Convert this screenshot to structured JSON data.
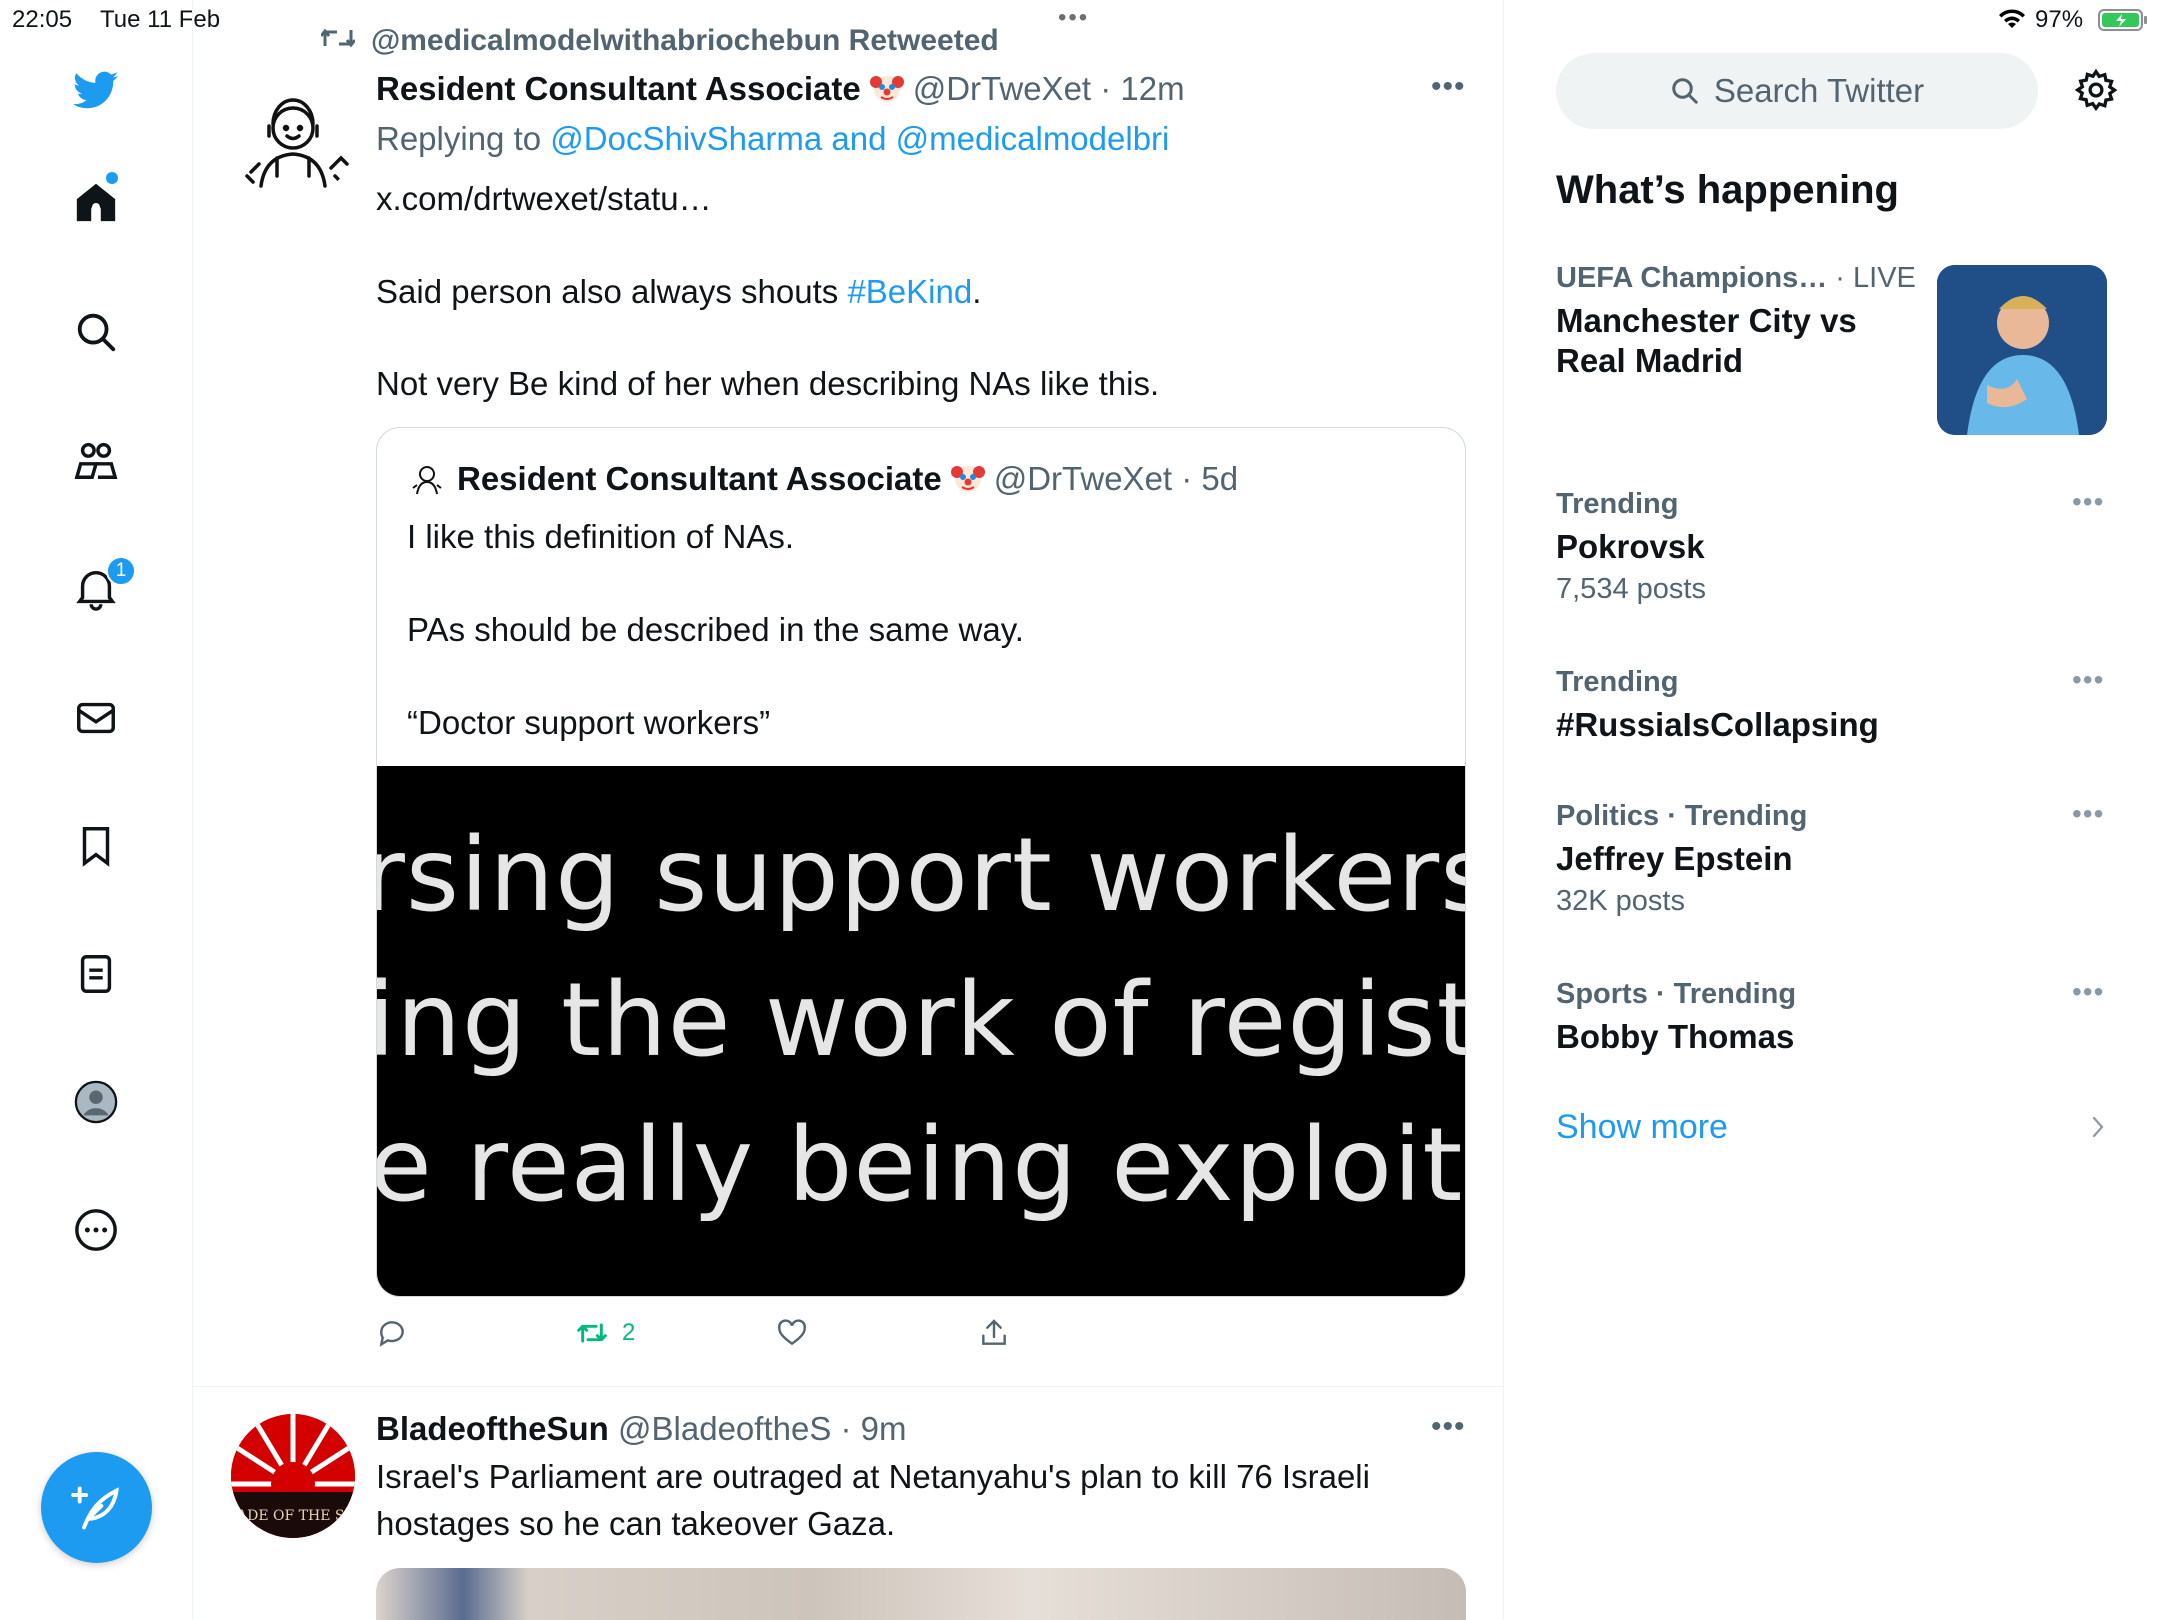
{
  "status_bar": {
    "time": "22:05",
    "date": "Tue 11 Feb",
    "multitask_dots": "•••",
    "battery_percent": "97%"
  },
  "nav": {
    "items": [
      {
        "name": "home-icon"
      },
      {
        "name": "search-icon"
      },
      {
        "name": "communities-icon"
      },
      {
        "name": "notifications-icon"
      },
      {
        "name": "messages-icon"
      },
      {
        "name": "bookmarks-icon"
      },
      {
        "name": "lists-icon"
      },
      {
        "name": "profile-icon"
      },
      {
        "name": "more-icon"
      }
    ],
    "notification_badge": "1",
    "accent": "#1d9bf0"
  },
  "timeline": {
    "retweeted_by": "@medicalmodelwithabriochebun Retweeted",
    "tweet1": {
      "name": "Resident Consultant Associate",
      "handle_time": "@DrTweXet · 12m",
      "replying_prefix": "Replying to",
      "replying_to": "@DocShivSharma and @medicalmodelbri",
      "link": "x.com/drtwexet/statu…",
      "line1_prefix": "Said person also always shouts",
      "line1_hashtag": "#BeKind",
      "line1_suffix": ".",
      "line2": "Not very Be kind of her when describing NAs like this.",
      "quote": {
        "name": "Resident Consultant Associate",
        "handle_time": "@DrTweXet · 5d",
        "line1": "I like this definition of NAs.",
        "line2": "PAs should be described in the same way.",
        "line3": "“Doctor support workers”",
        "image_line1": "rsing support workers.",
        "image_line2": "ing the work of registe",
        "image_line3": "e really being exploited"
      },
      "retweet_count": "2"
    },
    "tweet2": {
      "name": "BladeoftheSun",
      "handle_time": "@BladeoftheS · 9m",
      "line1": "Israel's Parliament are outraged at Netanyahu's plan to kill 76 Israeli",
      "line2": "hostages so he can takeover Gaza.",
      "avatar_text": "BLADE OF THE SUN"
    }
  },
  "sidebar": {
    "search_placeholder": "Search Twitter",
    "whats_happening": "What’s happening",
    "trends": [
      {
        "meta": "UEFA Champions…",
        "live": " · LIVE",
        "title_line1": "Manchester City vs",
        "title_line2": "Real Madrid"
      },
      {
        "meta": "Trending",
        "title": "Pokrovsk",
        "posts": "7,534 posts"
      },
      {
        "meta": "Trending",
        "title": "#RussiaIsCollapsing"
      },
      {
        "meta": "Politics · Trending",
        "title": "Jeffrey Epstein",
        "posts": "32K posts"
      },
      {
        "meta": "Sports · Trending",
        "title": "Bobby Thomas"
      }
    ],
    "show_more": "Show more"
  }
}
